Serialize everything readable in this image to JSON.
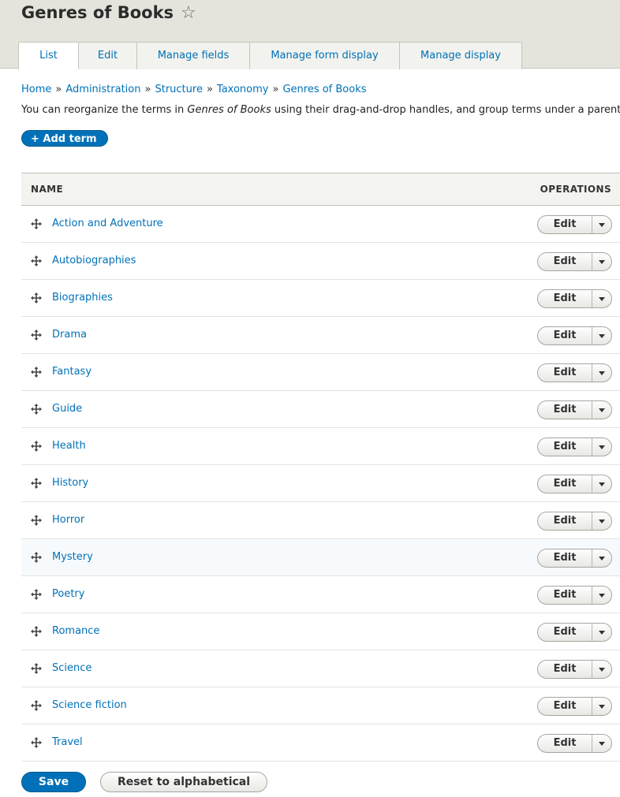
{
  "header": {
    "title": "Genres of Books",
    "tabs": [
      {
        "label": "List",
        "active": true
      },
      {
        "label": "Edit"
      },
      {
        "label": "Manage fields"
      },
      {
        "label": "Manage form display"
      },
      {
        "label": "Manage display"
      }
    ]
  },
  "breadcrumb": {
    "items": [
      "Home",
      "Administration",
      "Structure",
      "Taxonomy",
      "Genres of Books"
    ],
    "separator": "»"
  },
  "description": {
    "before": "You can reorganize the terms in ",
    "vocabulary": "Genres of Books",
    "after": " using their drag-and-drop handles, and group terms under a parent"
  },
  "add_term_label": "+ Add term",
  "table": {
    "headers": {
      "name": "NAME",
      "operations": "OPERATIONS"
    },
    "edit_label": "Edit",
    "rows": [
      "Action and Adventure",
      "Autobiographies",
      "Biographies",
      "Drama",
      "Fantasy",
      "Guide",
      "Health",
      "History",
      "Horror",
      "Mystery",
      "Poetry",
      "Romance",
      "Science",
      "Science fiction",
      "Travel"
    ],
    "hovered_row": "Mystery"
  },
  "footer": {
    "save_label": "Save",
    "reset_label": "Reset to alphabetical"
  },
  "colors": {
    "accent": "#0071b8",
    "header_bg": "#e5e4dc"
  },
  "icons": {
    "favorite": "star-outline-icon",
    "drag": "drag-handle-icon",
    "dropdown": "chevron-down-icon"
  }
}
